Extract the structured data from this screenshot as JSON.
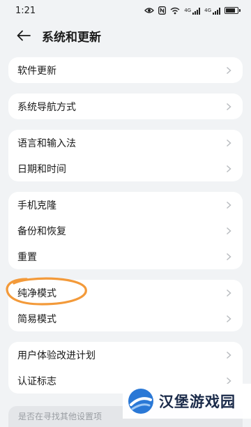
{
  "status": {
    "time": "1:21",
    "battery_level": 0.85,
    "network_labels": [
      "4G",
      "4G"
    ]
  },
  "header": {
    "title": "系统和更新"
  },
  "groups": [
    {
      "items": [
        "软件更新"
      ]
    },
    {
      "items": [
        "系统导航方式"
      ]
    },
    {
      "items": [
        "语言和输入法",
        "日期和时间"
      ]
    },
    {
      "items": [
        "手机克隆",
        "备份和恢复",
        "重置"
      ]
    },
    {
      "items": [
        "纯净模式",
        "简易模式"
      ]
    },
    {
      "items": [
        "用户体验改进计划",
        "认证标志"
      ]
    }
  ],
  "hint": "是否在寻找其他设置项",
  "watermark": {
    "text": "汉堡游戏园"
  },
  "colors": {
    "annotation": "#f39a3a",
    "chevron": "#b9bcc0",
    "watermark_blue": "#2a78d6",
    "watermark_dark": "#1b2b4a"
  },
  "icons": {
    "back": "arrow-left-icon",
    "chevron": "chevron-right-icon"
  }
}
